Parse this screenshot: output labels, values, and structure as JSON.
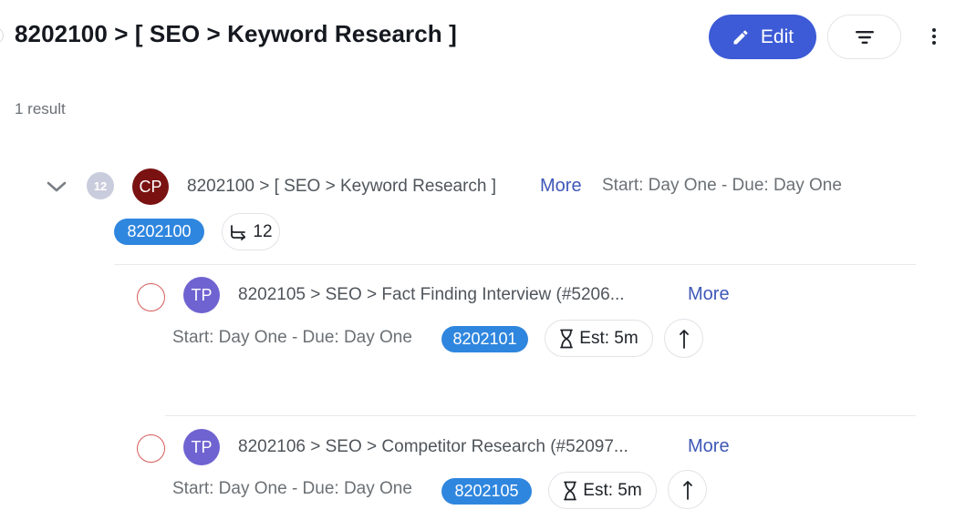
{
  "header": {
    "title": "8202100 > [ SEO > Keyword Research ]",
    "edit_label": "Edit"
  },
  "result_count": "1 result",
  "parent_task": {
    "subtask_count": "12",
    "avatar_initials": "CP",
    "title": "8202100 > [ SEO > Keyword Research ]",
    "more_label": "More",
    "dates": "Start: Day One - Due: Day One",
    "id_tag": "8202100",
    "subtasks_label": "12"
  },
  "subtasks": [
    {
      "avatar_initials": "TP",
      "title": "8202105 > SEO > Fact Finding Interview (#5206...",
      "more_label": "More",
      "dates": "Start: Day One - Due: Day One",
      "id_tag": "8202101",
      "estimate": "Est: 5m"
    },
    {
      "avatar_initials": "TP",
      "title": "8202106 > SEO > Competitor Research (#52097...",
      "more_label": "More",
      "dates": "Start: Day One - Due: Day One",
      "id_tag": "8202105",
      "estimate": "Est: 5m"
    }
  ],
  "colors": {
    "accent": "#3d5bd6",
    "id_tag": "#2f86de",
    "link": "#3f58b8",
    "checkbox_border": "#d75a5a"
  }
}
